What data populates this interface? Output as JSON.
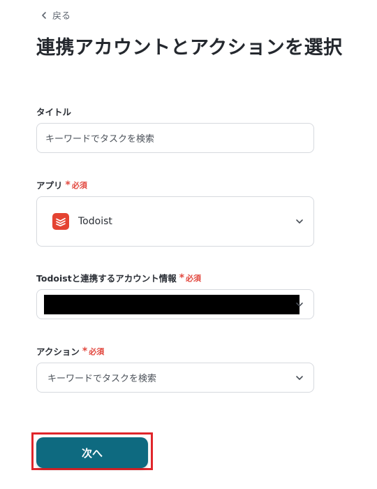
{
  "nav": {
    "back_label": "戻る"
  },
  "page": {
    "title": "連携アカウントとアクションを選択"
  },
  "form": {
    "title_field": {
      "label": "タイトル",
      "value": "キーワードでタスクを検索"
    },
    "app_field": {
      "label": "アプリ",
      "required_label": "必須",
      "value": "Todoist"
    },
    "account_field": {
      "label": "Todoistと連携するアカウント情報",
      "required_label": "必須"
    },
    "action_field": {
      "label": "アクション",
      "required_label": "必須",
      "value": "キーワードでタスクを検索"
    }
  },
  "actions": {
    "next_label": "次へ"
  },
  "colors": {
    "primary": "#0e6a80",
    "required": "#e2483f",
    "highlight": "#e0262b",
    "todoist_brand": "#e44332"
  }
}
